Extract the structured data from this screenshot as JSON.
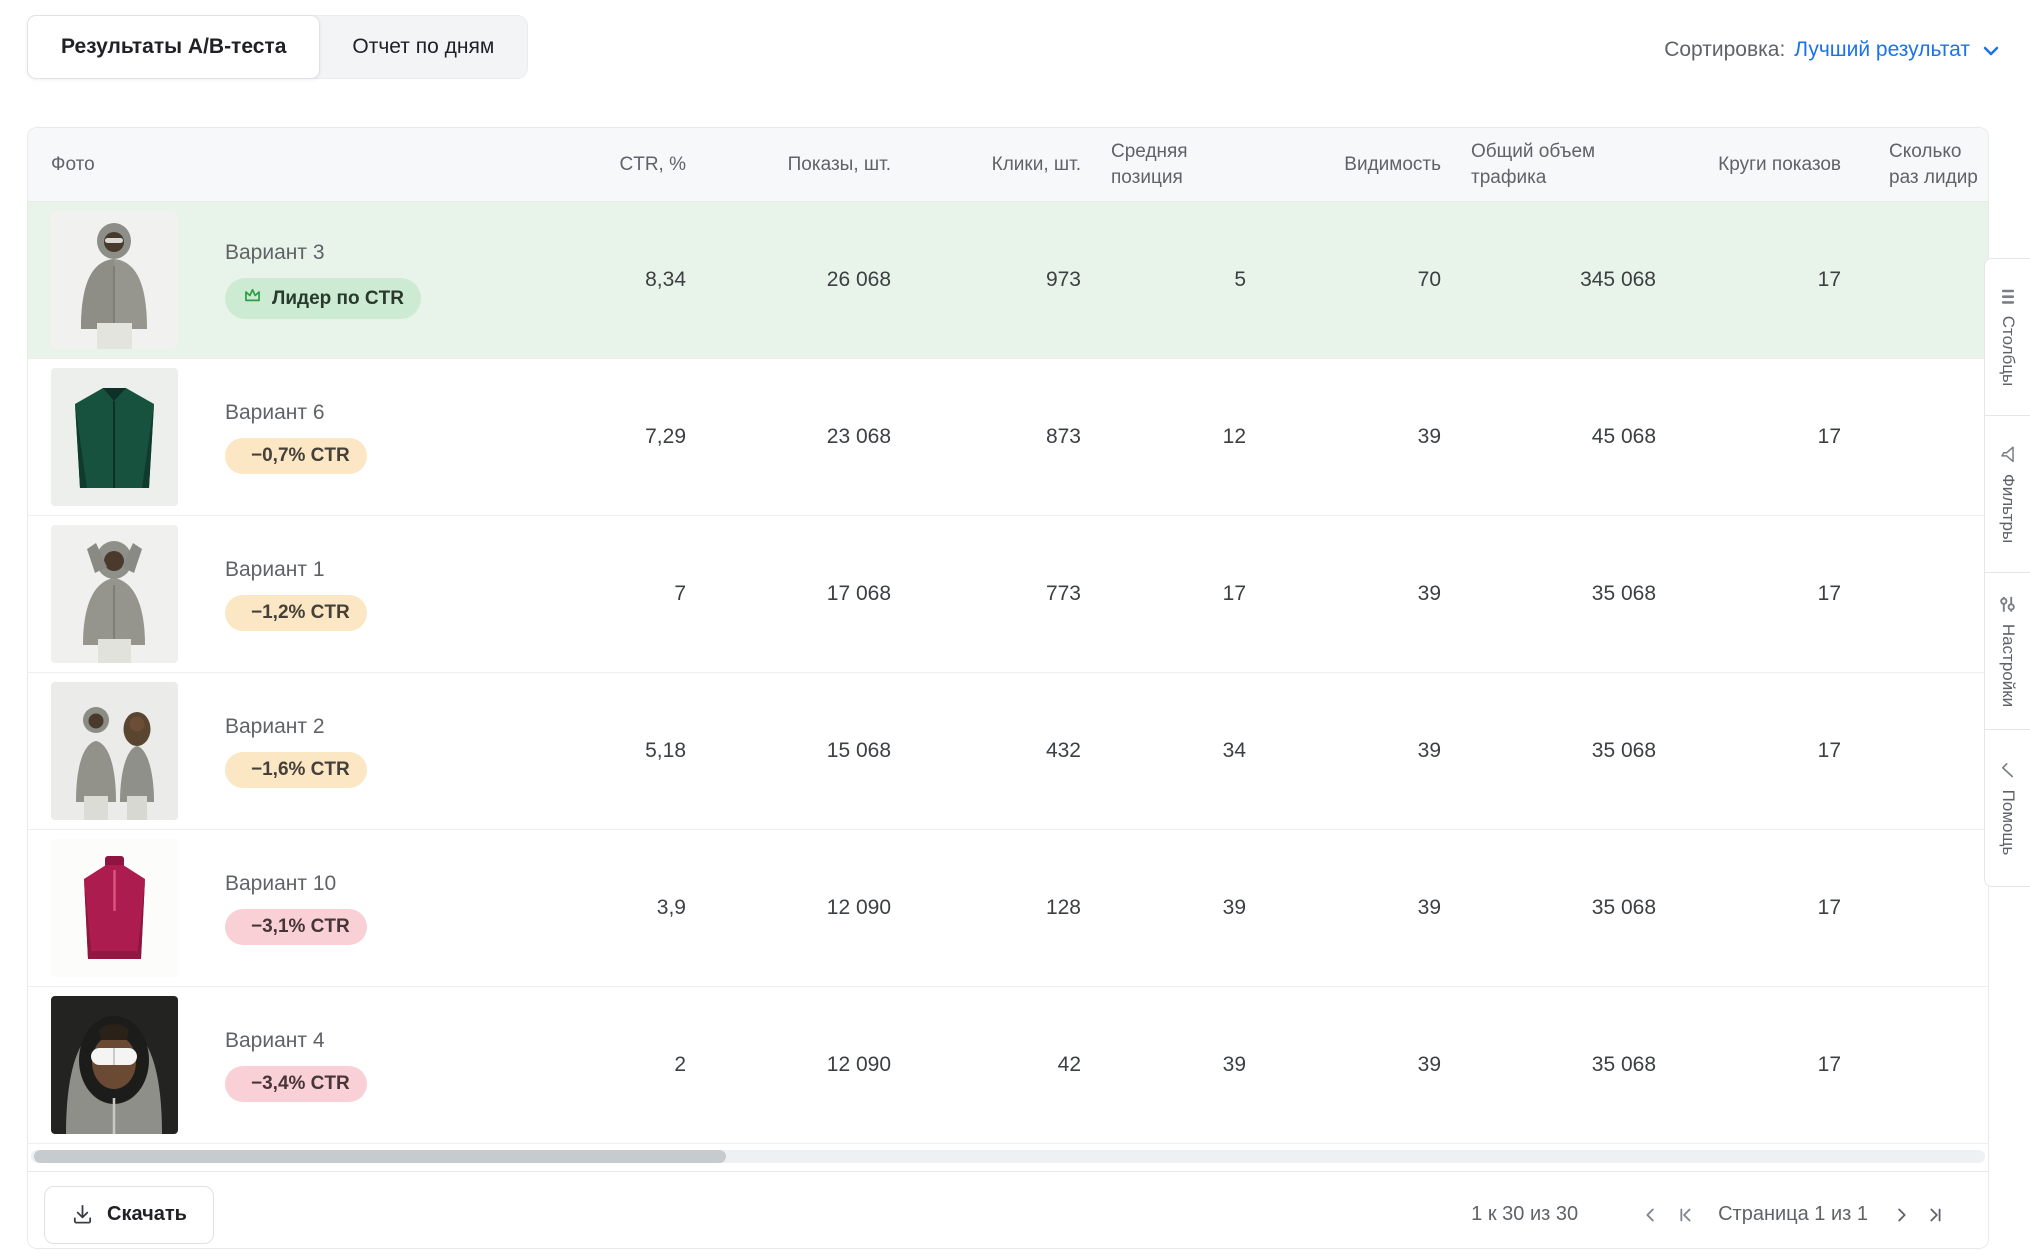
{
  "tabs": [
    {
      "label": "Результаты A/B-теста",
      "active": true
    },
    {
      "label": "Отчет по дням",
      "active": false
    }
  ],
  "sort": {
    "label": "Сортировка:",
    "value": "Лучший результат"
  },
  "table": {
    "columns": {
      "photo": "Фото",
      "ctr": "CTR, %",
      "shows": "Показы, шт.",
      "clicks": "Клики, шт.",
      "avg_pos": "Средняя позиция",
      "visibility": "Видимость",
      "traffic": "Общий объем трафика",
      "rounds": "Круги показов",
      "leader_line1": "Сколько",
      "leader_line2": "раз лидир"
    },
    "rows": [
      {
        "name": "Вариант 3",
        "badge": {
          "text": "Лидер по CTR",
          "type": "leader"
        },
        "photo": "model-gray-hoodie",
        "ctr": "8,34",
        "shows": "26 068",
        "clicks": "973",
        "avg_pos": "5",
        "visibility": "70",
        "traffic": "345 068",
        "rounds": "17",
        "highlight": true
      },
      {
        "name": "Вариант 6",
        "badge": {
          "text": "−0,7% CTR",
          "type": "warn"
        },
        "photo": "teal-jacket",
        "ctr": "7,29",
        "shows": "23 068",
        "clicks": "873",
        "avg_pos": "12",
        "visibility": "39",
        "traffic": "45 068",
        "rounds": "17",
        "highlight": false
      },
      {
        "name": "Вариант 1",
        "badge": {
          "text": "−1,2% CTR",
          "type": "warn"
        },
        "photo": "model-hood-arms-up",
        "ctr": "7",
        "shows": "17 068",
        "clicks": "773",
        "avg_pos": "17",
        "visibility": "39",
        "traffic": "35 068",
        "rounds": "17",
        "highlight": false
      },
      {
        "name": "Вариант 2",
        "badge": {
          "text": "−1,6% CTR",
          "type": "warn"
        },
        "photo": "two-models",
        "ctr": "5,18",
        "shows": "15 068",
        "clicks": "432",
        "avg_pos": "34",
        "visibility": "39",
        "traffic": "35 068",
        "rounds": "17",
        "highlight": false
      },
      {
        "name": "Вариант 10",
        "badge": {
          "text": "−3,1% CTR",
          "type": "bad"
        },
        "photo": "red-sweater",
        "ctr": "3,9",
        "shows": "12 090",
        "clicks": "128",
        "avg_pos": "39",
        "visibility": "39",
        "traffic": "35 068",
        "rounds": "17",
        "highlight": false
      },
      {
        "name": "Вариант 4",
        "badge": {
          "text": "−3,4% CTR",
          "type": "bad"
        },
        "photo": "portrait-goggles",
        "ctr": "2",
        "shows": "12 090",
        "clicks": "42",
        "avg_pos": "39",
        "visibility": "39",
        "traffic": "35 068",
        "rounds": "17",
        "highlight": false
      }
    ]
  },
  "side_rail": {
    "items": [
      {
        "label": "Столбцы",
        "icon": "columns-icon"
      },
      {
        "label": "Фильтры",
        "icon": "filter-icon"
      },
      {
        "label": "Настройки",
        "icon": "tune-icon"
      },
      {
        "label": "Помощь",
        "icon": "check-icon"
      }
    ]
  },
  "footer": {
    "download_label": "Скачать",
    "range_text": "1 к 30 из 30",
    "page_text": "Страница 1 из 1"
  },
  "colors": {
    "accent_blue": "#1a73e8",
    "highlight_row": "#e8f3ea",
    "badge_leader_bg": "#cdebd3",
    "badge_warn_bg": "#fbe7c4",
    "badge_bad_bg": "#f9d0d5",
    "crown_green": "#2f9e44",
    "header_bg": "#f7f8f9"
  }
}
